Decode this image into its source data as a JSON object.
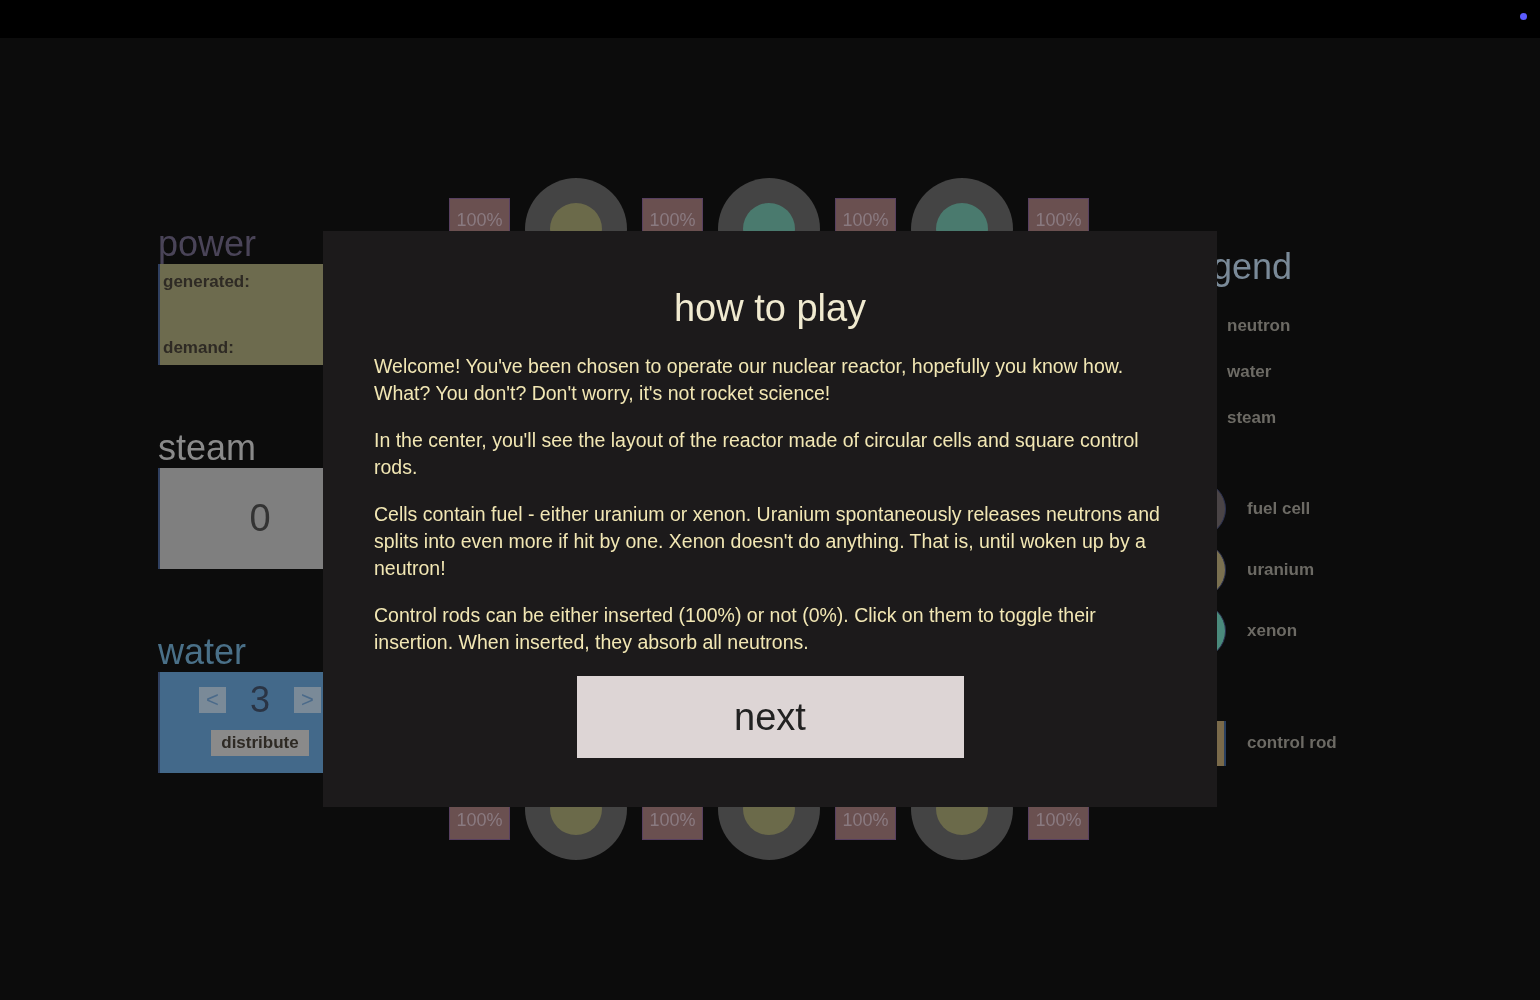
{
  "panels": {
    "power": {
      "title": "power",
      "labels": [
        "generated:",
        "demand:"
      ]
    },
    "steam": {
      "title": "steam",
      "value": "0"
    },
    "water": {
      "title": "water",
      "decrease": "<",
      "value": "3",
      "increase": ">",
      "button": "distribute"
    }
  },
  "reactor": {
    "rows": [
      [
        {
          "kind": "rod",
          "label": "100%"
        },
        {
          "kind": "uranium"
        },
        {
          "kind": "rod",
          "label": "100%"
        },
        {
          "kind": "xenon"
        },
        {
          "kind": "rod",
          "label": "100%"
        },
        {
          "kind": "xenon"
        },
        {
          "kind": "rod",
          "label": "100%"
        }
      ],
      [
        {
          "kind": "rod",
          "label": "100%"
        },
        {
          "kind": "uranium"
        },
        {
          "kind": "rod",
          "label": "100%"
        },
        {
          "kind": "uranium"
        },
        {
          "kind": "rod",
          "label": "100%"
        },
        {
          "kind": "uranium"
        },
        {
          "kind": "rod",
          "label": "100%"
        }
      ]
    ]
  },
  "legend": {
    "title": "gend",
    "items": [
      {
        "kind": "particle",
        "label": "neutron"
      },
      {
        "kind": "particle",
        "label": "water"
      },
      {
        "kind": "particle",
        "label": "steam"
      },
      {
        "kind": "cell",
        "label": "fuel cell"
      },
      {
        "kind": "uranium",
        "label": "uranium"
      },
      {
        "kind": "xenon",
        "label": "xenon"
      },
      {
        "kind": "rod",
        "label": "control rod"
      }
    ]
  },
  "dialog": {
    "title": "how to play",
    "paragraphs": [
      "Welcome! You've been chosen to operate our nuclear reactor, hopefully you know how. What? You don't? Don't worry, it's not rocket science!",
      "In the center, you'll see the layout of the reactor made of circular cells and square control rods.",
      "Cells contain fuel - either uranium or xenon. Uranium spontaneously releases neutrons and splits into even more if hit by one. Xenon doesn't do anything. That is, until woken up by a neutron!",
      "Control rods can be either inserted (100%) or not (0%). Click on them to toggle their insertion. When inserted, they absorb all neutrons."
    ],
    "button": "next"
  }
}
